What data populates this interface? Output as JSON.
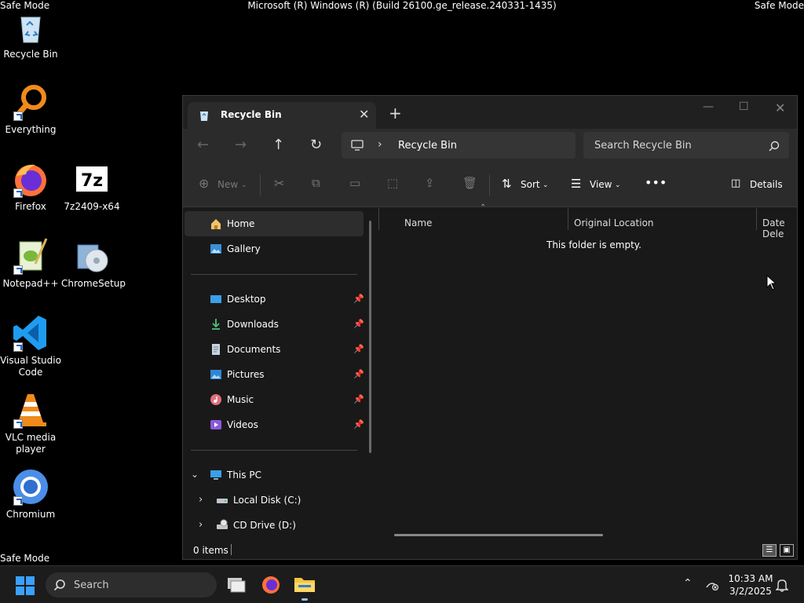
{
  "system": {
    "safe_mode_label": "Safe Mode",
    "build_info": "Microsoft (R) Windows (R) (Build 26100.ge_release.240331-1435)"
  },
  "desktop": {
    "icons": {
      "recycle_bin": "Recycle Bin",
      "everything": "Everything",
      "firefox": "Firefox",
      "sevenzip": "7z2409-x64",
      "notepadpp": "Notepad++",
      "chromesetup": "ChromeSetup",
      "vscode": "Visual Studio Code",
      "vlc": "VLC media player",
      "chromium": "Chromium"
    }
  },
  "explorer": {
    "tab_title": "Recycle Bin",
    "address": "Recycle Bin",
    "search_placeholder": "Search Recycle Bin",
    "commands": {
      "new": "New",
      "sort": "Sort",
      "view": "View",
      "details": "Details"
    },
    "nav": {
      "home": "Home",
      "gallery": "Gallery",
      "desktop": "Desktop",
      "downloads": "Downloads",
      "documents": "Documents",
      "pictures": "Pictures",
      "music": "Music",
      "videos": "Videos",
      "this_pc": "This PC",
      "local_disk": "Local Disk (C:)",
      "cd_drive": "CD Drive (D:)"
    },
    "columns": {
      "name": "Name",
      "original_location": "Original Location",
      "date_deleted": "Date Dele"
    },
    "empty_message": "This folder is empty.",
    "status": "0 items"
  },
  "taskbar": {
    "search_label": "Search",
    "time": "10:33 AM",
    "date": "3/2/2025"
  }
}
